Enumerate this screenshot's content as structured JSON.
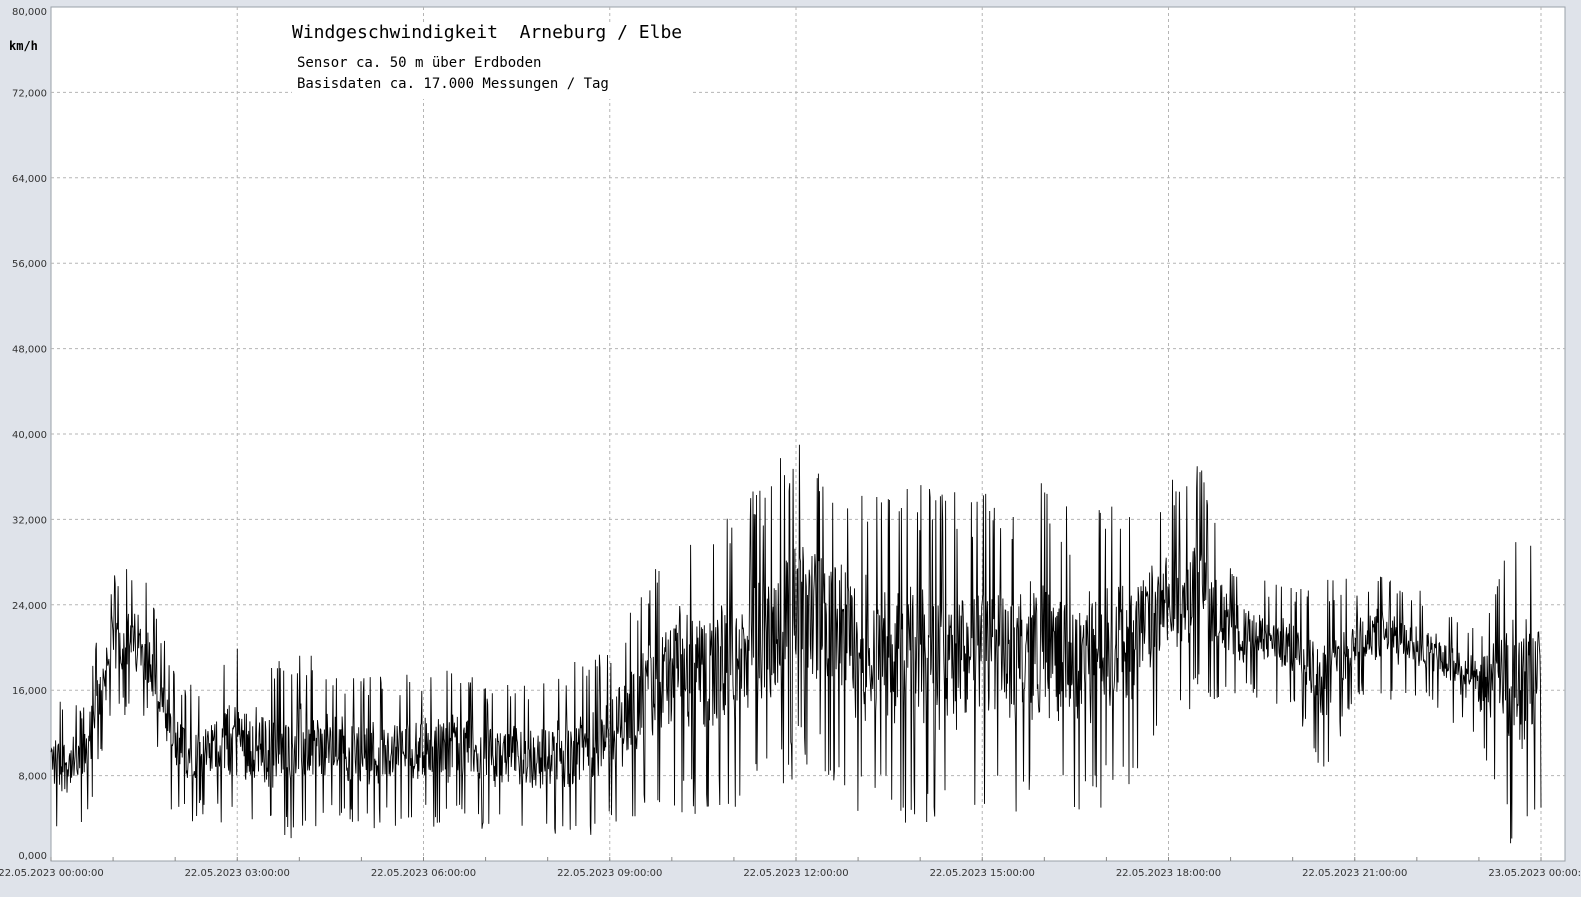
{
  "chart_data": {
    "type": "line",
    "title": "Windgeschwindigkeit  Arneburg / Elbe",
    "subtitle_lines": [
      "Sensor ca. 50 m über Erdboden",
      "Basisdaten ca. 17.000 Messungen / Tag"
    ],
    "ylabel": "km/h",
    "ylim": [
      0,
      80000
    ],
    "y_ticks": [
      "0,000",
      "8,000",
      "16,000",
      "24,000",
      "32,000",
      "40,000",
      "48,000",
      "56,000",
      "64,000",
      "72,000",
      "80,000"
    ],
    "x_ticks": [
      "22.05.2023  00:00:00",
      "22.05.2023  03:00:00",
      "22.05.2023  06:00:00",
      "22.05.2023  09:00:00",
      "22.05.2023  12:00:00",
      "22.05.2023  15:00:00",
      "22.05.2023  18:00:00",
      "22.05.2023  21:00:00",
      "23.05.2023  00:00:00"
    ],
    "x_hours_range": [
      0,
      24
    ],
    "grid": true,
    "series": [
      {
        "color": "#000000",
        "envelope_by_half_hour": [
          {
            "hour": 0.0,
            "min": 3000,
            "max": 16000
          },
          {
            "hour": 0.5,
            "min": 2500,
            "max": 15000
          },
          {
            "hour": 1.0,
            "min": 13000,
            "max": 28000
          },
          {
            "hour": 1.5,
            "min": 13500,
            "max": 27000
          },
          {
            "hour": 2.0,
            "min": 3000,
            "max": 17500
          },
          {
            "hour": 2.5,
            "min": 4000,
            "max": 16000
          },
          {
            "hour": 3.0,
            "min": 2500,
            "max": 21000
          },
          {
            "hour": 3.5,
            "min": 2000,
            "max": 18500
          },
          {
            "hour": 4.0,
            "min": 2000,
            "max": 20000
          },
          {
            "hour": 4.5,
            "min": 3000,
            "max": 18000
          },
          {
            "hour": 5.0,
            "min": 3000,
            "max": 17500
          },
          {
            "hour": 5.5,
            "min": 3000,
            "max": 17500
          },
          {
            "hour": 6.0,
            "min": 3000,
            "max": 18000
          },
          {
            "hour": 6.5,
            "min": 3000,
            "max": 18500
          },
          {
            "hour": 7.0,
            "min": 3000,
            "max": 16500
          },
          {
            "hour": 7.5,
            "min": 3000,
            "max": 16500
          },
          {
            "hour": 8.0,
            "min": 2500,
            "max": 17000
          },
          {
            "hour": 8.5,
            "min": 2000,
            "max": 19000
          },
          {
            "hour": 9.0,
            "min": 3000,
            "max": 20000
          },
          {
            "hour": 9.5,
            "min": 4000,
            "max": 26000
          },
          {
            "hour": 10.0,
            "min": 4000,
            "max": 32000
          },
          {
            "hour": 10.5,
            "min": 4000,
            "max": 31000
          },
          {
            "hour": 11.0,
            "min": 4000,
            "max": 33000
          },
          {
            "hour": 11.5,
            "min": 5000,
            "max": 36000
          },
          {
            "hour": 12.0,
            "min": 8000,
            "max": 40000
          },
          {
            "hour": 12.5,
            "min": 8000,
            "max": 37000
          },
          {
            "hour": 13.0,
            "min": 4000,
            "max": 36500
          },
          {
            "hour": 13.5,
            "min": 3000,
            "max": 36500
          },
          {
            "hour": 14.0,
            "min": 2500,
            "max": 35500
          },
          {
            "hour": 14.5,
            "min": 3000,
            "max": 34500
          },
          {
            "hour": 15.0,
            "min": 5000,
            "max": 35000
          },
          {
            "hour": 15.5,
            "min": 4000,
            "max": 34000
          },
          {
            "hour": 16.0,
            "min": 4000,
            "max": 36500
          },
          {
            "hour": 16.5,
            "min": 4500,
            "max": 32000
          },
          {
            "hour": 17.0,
            "min": 5000,
            "max": 35500
          },
          {
            "hour": 17.5,
            "min": 8000,
            "max": 34500
          },
          {
            "hour": 18.0,
            "min": 12000,
            "max": 35500
          },
          {
            "hour": 18.5,
            "min": 15000,
            "max": 37500
          },
          {
            "hour": 19.0,
            "min": 15000,
            "max": 28000
          },
          {
            "hour": 19.5,
            "min": 15000,
            "max": 26500
          },
          {
            "hour": 20.0,
            "min": 14000,
            "max": 26000
          },
          {
            "hour": 20.5,
            "min": 7000,
            "max": 26500
          },
          {
            "hour": 21.0,
            "min": 15000,
            "max": 26500
          },
          {
            "hour": 21.5,
            "min": 15000,
            "max": 27500
          },
          {
            "hour": 22.0,
            "min": 15000,
            "max": 25500
          },
          {
            "hour": 22.5,
            "min": 13000,
            "max": 24000
          },
          {
            "hour": 23.0,
            "min": 11000,
            "max": 22000
          },
          {
            "hour": 23.5,
            "min": 1500,
            "max": 31500
          }
        ]
      }
    ]
  }
}
